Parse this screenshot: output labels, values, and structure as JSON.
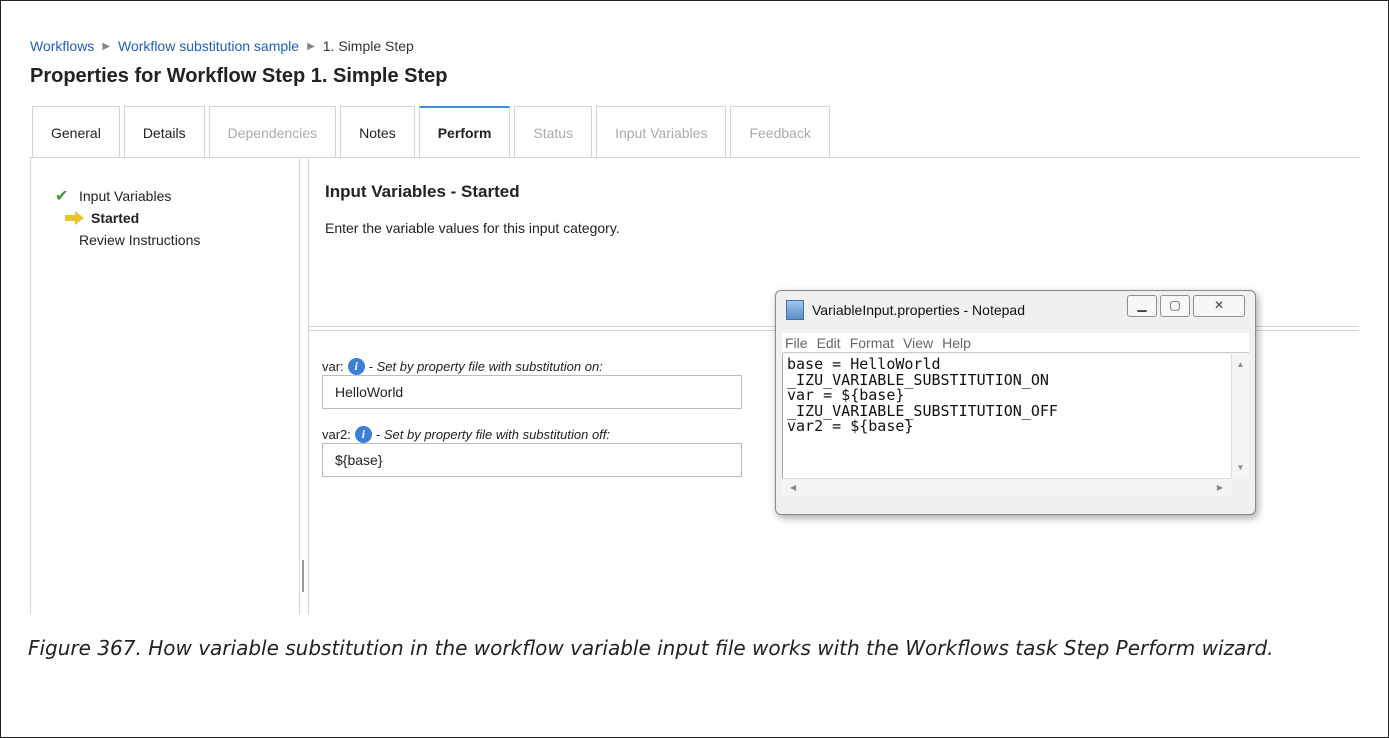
{
  "breadcrumb": {
    "items": [
      "Workflows",
      "Workflow substitution sample",
      "1. Simple Step"
    ]
  },
  "page_title": "Properties for Workflow Step 1. Simple Step",
  "tabs": [
    {
      "label": "General",
      "state": "enabled"
    },
    {
      "label": "Details",
      "state": "enabled"
    },
    {
      "label": "Dependencies",
      "state": "disabled"
    },
    {
      "label": "Notes",
      "state": "enabled"
    },
    {
      "label": "Perform",
      "state": "active"
    },
    {
      "label": "Status",
      "state": "disabled"
    },
    {
      "label": "Input Variables",
      "state": "disabled"
    },
    {
      "label": "Feedback",
      "state": "disabled"
    }
  ],
  "nav": {
    "input_variables": "Input Variables",
    "started": "Started",
    "review": "Review Instructions"
  },
  "main": {
    "heading": "Input Variables - Started",
    "description": "Enter the variable values for this input category."
  },
  "fields": [
    {
      "name": "var:",
      "note": "- Set by property file with substitution on:",
      "value": "HelloWorld"
    },
    {
      "name": "var2:",
      "note": "- Set by property file with substitution off:",
      "value": "${base}"
    }
  ],
  "notepad": {
    "title": "VariableInput.properties - Notepad",
    "menu": [
      "File",
      "Edit",
      "Format",
      "View",
      "Help"
    ],
    "lines": [
      "base = HelloWorld",
      "_IZU_VARIABLE_SUBSTITUTION_ON",
      "var = ${base}",
      "_IZU_VARIABLE_SUBSTITUTION_OFF",
      "var2 = ${base}"
    ]
  },
  "caption": "Figure 367. How variable substitution in the workflow variable input file works with the Workflows task Step Perform wizard.",
  "colors": {
    "link": "#1f5fb7",
    "active_tab_accent": "#3a8fd8",
    "info_icon": "#3b7fd6",
    "check": "#3a9a2a",
    "arrow": "#e9c52a"
  }
}
